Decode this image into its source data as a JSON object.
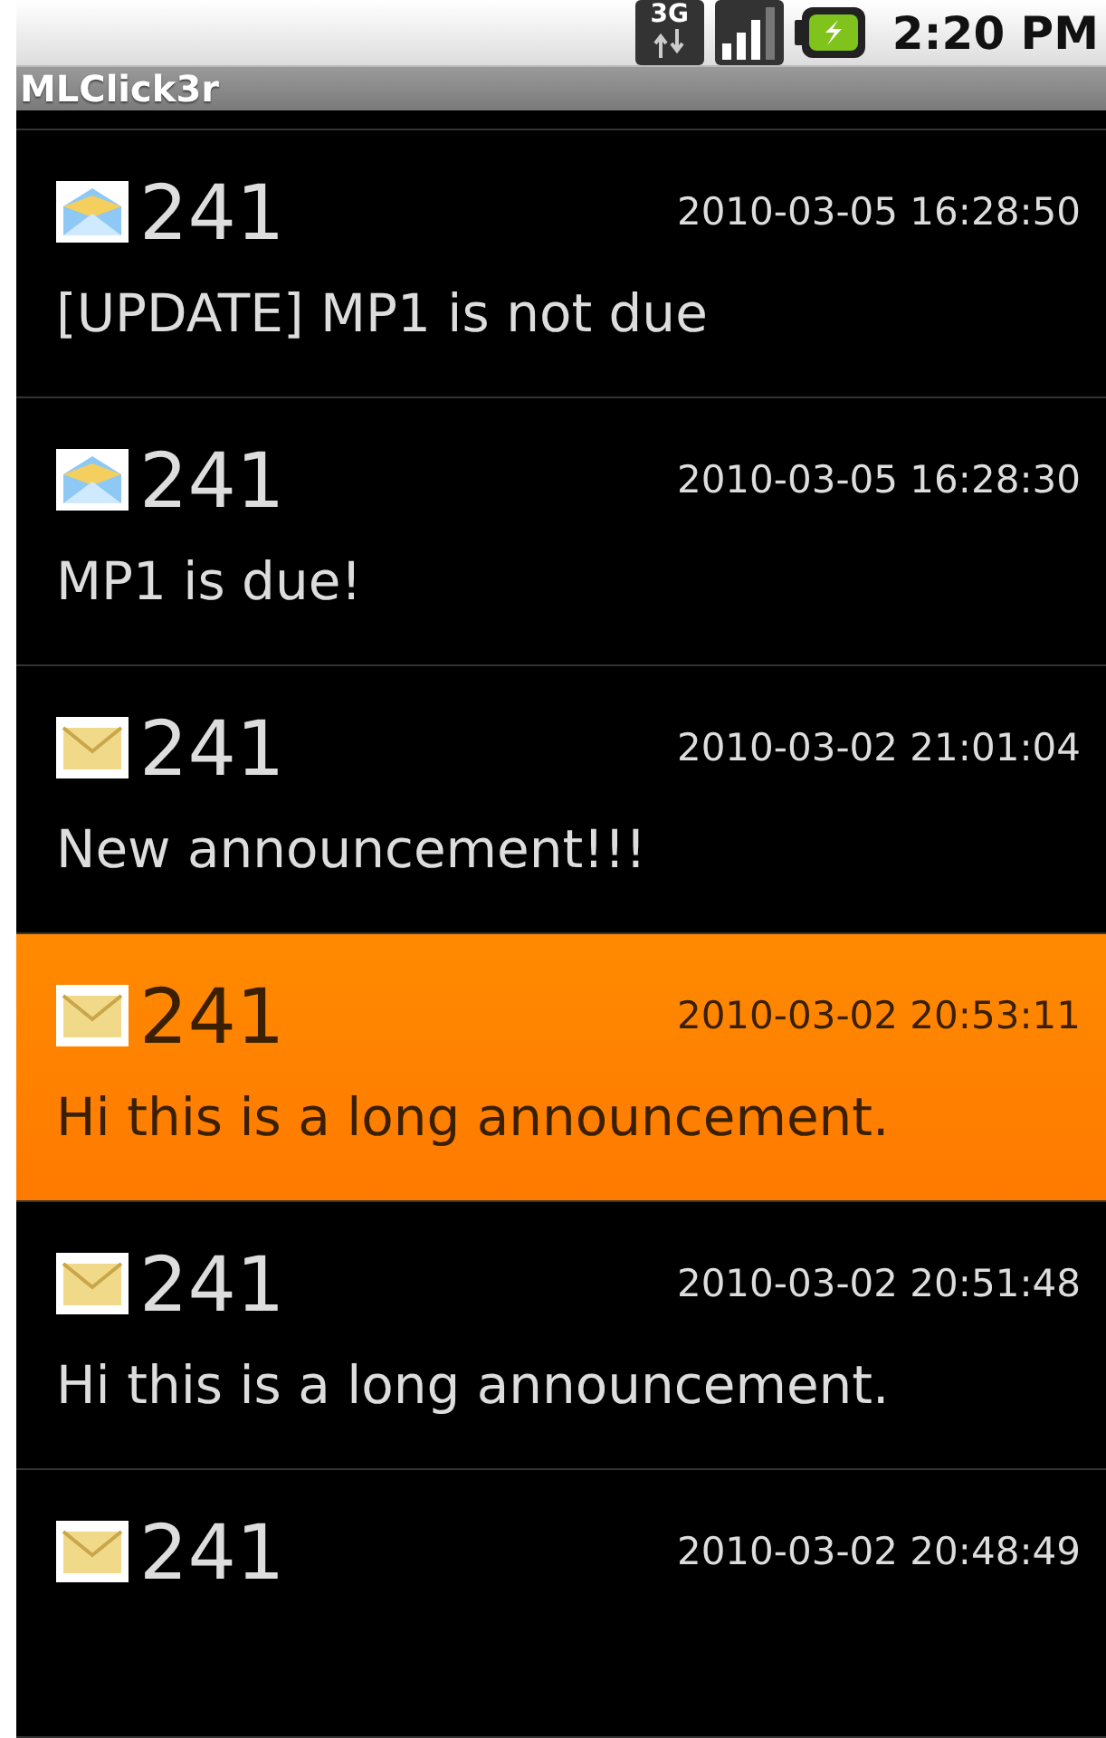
{
  "status_bar": {
    "network": "3G",
    "time": "2:20 PM"
  },
  "title_bar": {
    "title": "MLClick3r"
  },
  "messages": [
    {
      "sender": "241",
      "timestamp": "2010-03-05 16:28:50",
      "text": "[UPDATE] MP1 is not due",
      "read": true,
      "selected": false
    },
    {
      "sender": "241",
      "timestamp": "2010-03-05 16:28:30",
      "text": "MP1 is due!",
      "read": true,
      "selected": false
    },
    {
      "sender": "241",
      "timestamp": "2010-03-02 21:01:04",
      "text": "New announcement!!!",
      "read": false,
      "selected": false
    },
    {
      "sender": "241",
      "timestamp": "2010-03-02 20:53:11",
      "text": "Hi this is a long announcement.",
      "read": false,
      "selected": true
    },
    {
      "sender": "241",
      "timestamp": "2010-03-02 20:51:48",
      "text": "Hi this is a long announcement.",
      "read": false,
      "selected": false
    },
    {
      "sender": "241",
      "timestamp": "2010-03-02 20:48:49",
      "read": false,
      "selected": false
    }
  ]
}
